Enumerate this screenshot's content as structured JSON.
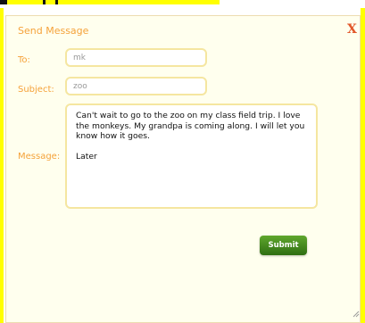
{
  "dialog": {
    "title": "Send Message",
    "close_label": "X",
    "fields": {
      "to": {
        "label": "To:",
        "value": "mk"
      },
      "subject": {
        "label": "Subject:",
        "value": "zoo"
      },
      "message": {
        "label": "Message:",
        "value": "Can't wait to go to the zoo on my class field trip. I love the monkeys. My grandpa is coming along. I will let you know how it goes.\n\nLater"
      }
    },
    "submit_label": "Submit"
  },
  "colors": {
    "label": "#f5a23a",
    "close": "#e2572a",
    "submit": "#3f8a1c",
    "dialog_bg": "#ffffee",
    "side_bars": "#ffff00"
  },
  "icons": {
    "close": "close-icon",
    "resize": "resize-grip-icon"
  }
}
